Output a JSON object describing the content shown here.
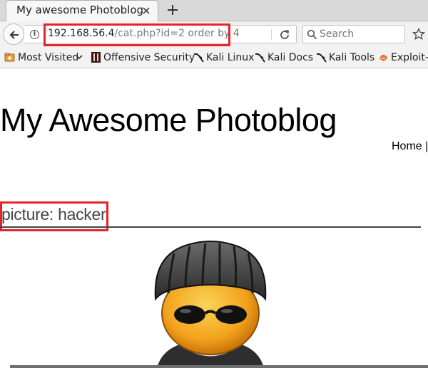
{
  "browser": {
    "tab": {
      "title": "My awesome Photoblog"
    },
    "nav": {
      "url_host": "192.168.56.4",
      "url_path": "/cat.php?id=2 order by 4",
      "search_placeholder": "Search"
    },
    "bookmarks": [
      {
        "label": "Most Visited",
        "icon": "gear-folder-icon",
        "has_dropdown": true
      },
      {
        "label": "Offensive Security",
        "icon": "offsec-icon"
      },
      {
        "label": "Kali Linux",
        "icon": "kali-dragon-icon"
      },
      {
        "label": "Kali Docs",
        "icon": "kali-dragon-icon"
      },
      {
        "label": "Kali Tools",
        "icon": "kali-dragon-icon"
      },
      {
        "label": "Exploit-D",
        "icon": "exploit-db-icon"
      }
    ]
  },
  "page": {
    "site_title": "My Awesome Photoblog",
    "menu": {
      "home_label": "Home",
      "separator": "|"
    },
    "post": {
      "title": "picture: hacker"
    }
  },
  "colors": {
    "highlight": "#e8222b",
    "url_path": "#777777",
    "heading": "#444444"
  }
}
